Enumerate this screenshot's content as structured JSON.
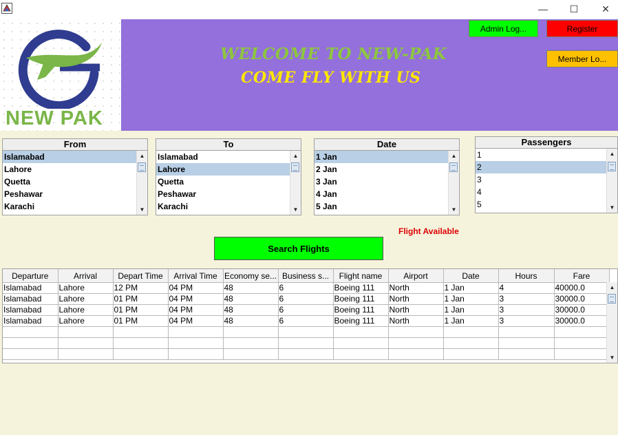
{
  "window": {
    "minimize": "—",
    "maximize": "☐",
    "close": "✕"
  },
  "logo": {
    "text": "NEW PAK"
  },
  "banner": {
    "line1": "WELCOME TO NEW-PAK",
    "line2": "COME FLY WITH US"
  },
  "buttons": {
    "admin": "Admin Log...",
    "register": "Register",
    "member": "Member Lo...",
    "search": "Search Flights"
  },
  "colors": {
    "banner": "#9370db",
    "admin": "#00ff00",
    "register": "#ff0000",
    "member": "#ffc000",
    "search": "#00ff00",
    "status": "#dd0000"
  },
  "from": {
    "title": "From",
    "items": [
      "Islamabad",
      "Lahore",
      "Quetta",
      "Peshawar",
      "Karachi"
    ],
    "selected": "Islamabad"
  },
  "to": {
    "title": "To",
    "items": [
      "Islamabad",
      "Lahore",
      "Quetta",
      "Peshawar",
      "Karachi"
    ],
    "selected": "Lahore"
  },
  "date": {
    "title": "Date",
    "items": [
      "1 Jan",
      "2 Jan",
      "3 Jan",
      "4 Jan",
      "5 Jan"
    ],
    "selected": "1 Jan"
  },
  "passengers": {
    "title": "Passengers",
    "items": [
      "1",
      "2",
      "3",
      "4",
      "5"
    ],
    "selected": "2"
  },
  "status": "Flight Available",
  "table": {
    "columns": [
      "Departure",
      "Arrival",
      "Depart Time",
      "Arrival Time",
      "Economy se...",
      "Business s...",
      "Flight name",
      "Airport",
      "Date",
      "Hours",
      "Fare"
    ],
    "rows": [
      [
        "Islamabad",
        "Lahore",
        "12 PM",
        "04 PM",
        "48",
        "6",
        "Boeing 111",
        "North",
        "1 Jan",
        "4",
        "40000.0"
      ],
      [
        "Islamabad",
        "Lahore",
        "01 PM",
        "04 PM",
        "48",
        "6",
        "Boeing 111",
        "North",
        "1 Jan",
        "3",
        "30000.0"
      ],
      [
        "Islamabad",
        "Lahore",
        "01 PM",
        "04 PM",
        "48",
        "6",
        "Boeing 111",
        "North",
        "1 Jan",
        "3",
        "30000.0"
      ],
      [
        "Islamabad",
        "Lahore",
        "01 PM",
        "04 PM",
        "48",
        "6",
        "Boeing 111",
        "North",
        "1 Jan",
        "3",
        "30000.0"
      ]
    ]
  }
}
